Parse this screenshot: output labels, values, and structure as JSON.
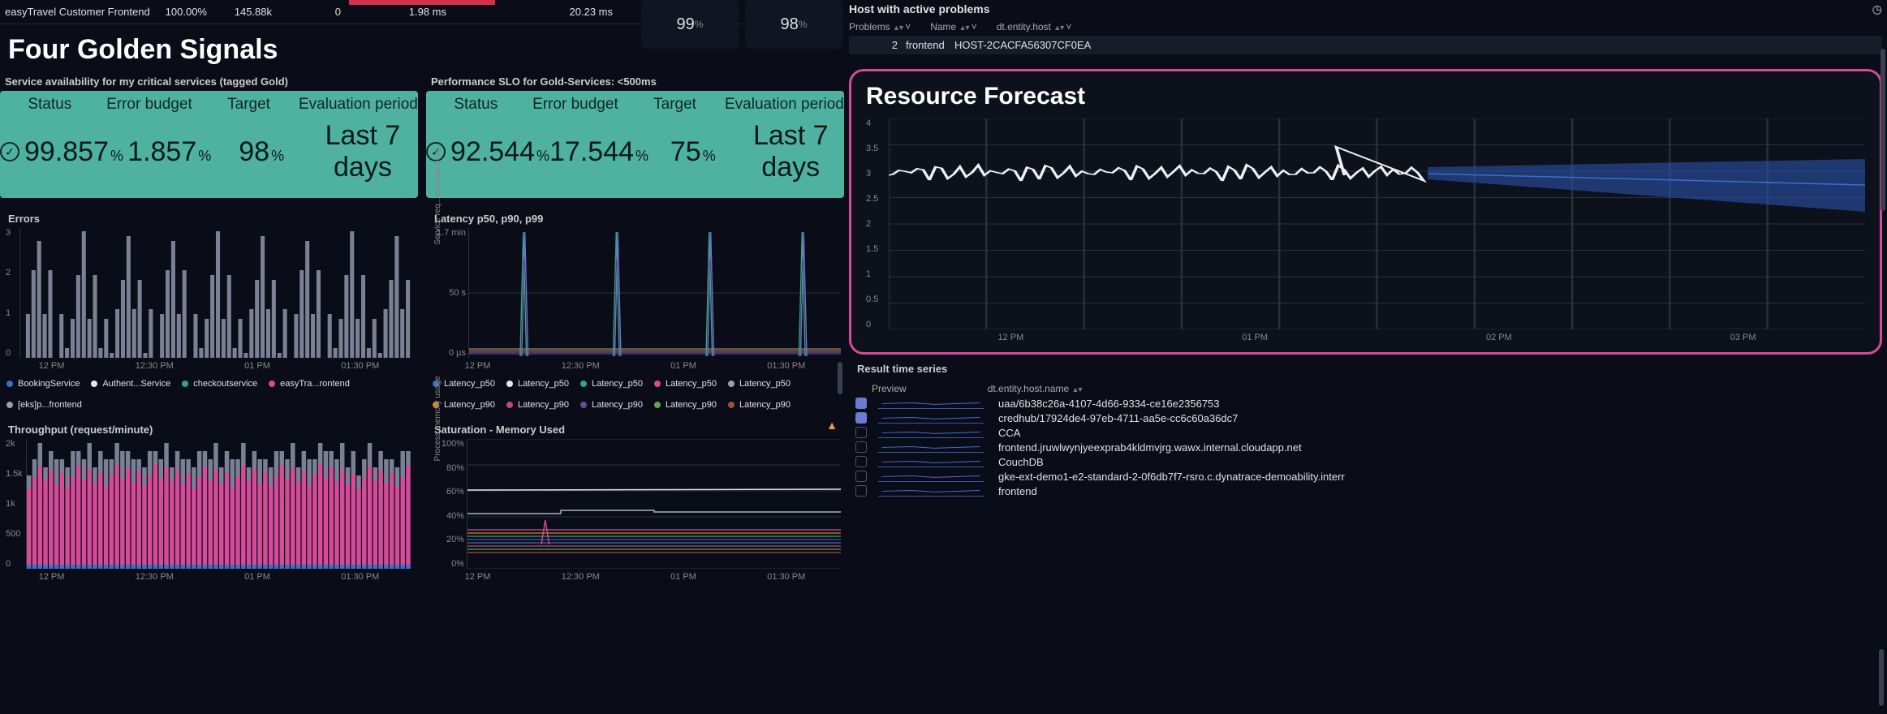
{
  "top_row": {
    "service": "easyTravel Customer Frontend",
    "pct": "100.00%",
    "val1": "145.88k",
    "val2": "0",
    "val3": "1.98 ms",
    "val4": "20.23 ms"
  },
  "gauges": {
    "g1": "99",
    "g1_unit": "%",
    "g2": "98",
    "g2_unit": "%"
  },
  "section_title": "Four Golden Signals",
  "slo1": {
    "title": "Service availability for my critical services (tagged Gold)",
    "headers": [
      "Status",
      "Error budget",
      "Target",
      "Evaluation period"
    ],
    "values": [
      "99.857",
      "1.857",
      "98",
      "Last 7 days"
    ]
  },
  "slo2": {
    "title": "Performance SLO for Gold-Services: <500ms",
    "headers": [
      "Status",
      "Error budget",
      "Target",
      "Evaluation period"
    ],
    "values": [
      "92.544",
      "17.544",
      "75",
      "Last 7 days"
    ]
  },
  "errors_chart": {
    "title": "Errors",
    "ylabels": [
      "3",
      "2",
      "1",
      "0"
    ],
    "xlabels": [
      "12 PM",
      "12:30 PM",
      "01 PM",
      "01:30 PM"
    ],
    "legend": [
      {
        "c": "#3b6fc9",
        "t": "BookingService"
      },
      {
        "c": "#e8e8e8",
        "t": "Authent...Service"
      },
      {
        "c": "#2fa87a",
        "t": "checkoutservice"
      },
      {
        "c": "#d64a9a",
        "t": "easyTra...rontend"
      },
      {
        "c": "#9aa0a6",
        "t": "[eks]p...frontend"
      }
    ]
  },
  "latency_chart": {
    "title": "Latency p50, p90, p99",
    "ylabels": [
      "1.7 min",
      "50 s",
      "0 µs"
    ],
    "ylabel_rot": "Service req...esponse time",
    "xlabels": [
      "12 PM",
      "12:30 PM",
      "01 PM",
      "01:30 PM"
    ],
    "legend": [
      {
        "c": "#3b6fc9",
        "t": "Latency_p50"
      },
      {
        "c": "#e8e8e8",
        "t": "Latency_p50"
      },
      {
        "c": "#2fa87a",
        "t": "Latency_p50"
      },
      {
        "c": "#d64a9a",
        "t": "Latency_p50"
      },
      {
        "c": "#9aa0a6",
        "t": "Latency_p50"
      },
      {
        "c": "#c98b2f",
        "t": "Latency_p90"
      },
      {
        "c": "#c14a6f",
        "t": "Latency_p90"
      },
      {
        "c": "#6a4aa0",
        "t": "Latency_p90"
      },
      {
        "c": "#6aa04a",
        "t": "Latency_p90"
      },
      {
        "c": "#a04a4a",
        "t": "Latency_p90"
      }
    ]
  },
  "throughput_chart": {
    "title": "Throughput (request/minute)",
    "ylabels": [
      "2k",
      "1.5k",
      "1k",
      "500",
      "0"
    ],
    "xlabels": [
      "12 PM",
      "12:30 PM",
      "01 PM",
      "01:30 PM"
    ]
  },
  "saturation_chart": {
    "title": "Saturation - Memory Used",
    "ylabels": [
      "100%",
      "80%",
      "60%",
      "40%",
      "20%",
      "0%"
    ],
    "ylabel_rot": "Process memory usage",
    "xlabels": [
      "12 PM",
      "12:30 PM",
      "01 PM",
      "01:30 PM"
    ]
  },
  "host_problems": {
    "title": "Host with active problems",
    "cols": [
      "Problems",
      "Name",
      "dt.entity.host"
    ],
    "row": {
      "problems": "2",
      "name": "frontend",
      "entity": "HOST-2CACFA56307CF0EA"
    }
  },
  "forecast": {
    "title": "Resource Forecast",
    "ylabels": [
      "4",
      "3.5",
      "3",
      "2.5",
      "2",
      "1.5",
      "1",
      "0.5",
      "0"
    ],
    "xlabels": [
      "12 PM",
      "01 PM",
      "02 PM",
      "03 PM"
    ]
  },
  "results": {
    "title": "Result time series",
    "cols": [
      "Preview",
      "dt.entity.host.name"
    ],
    "rows": [
      {
        "checked": true,
        "name": "uaa/6b38c26a-4107-4d66-9334-ce16e2356753"
      },
      {
        "checked": true,
        "name": "credhub/17924de4-97eb-4711-aa5e-cc6c60a36dc7"
      },
      {
        "checked": false,
        "name": "CCA"
      },
      {
        "checked": false,
        "name": "frontend.jruwlwynjyeexprab4kldmvjrg.wawx.internal.cloudapp.net"
      },
      {
        "checked": false,
        "name": "CouchDB"
      },
      {
        "checked": false,
        "name": "gke-ext-demo1-e2-standard-2-0f6db7f7-rsro.c.dynatrace-demoability.interr"
      },
      {
        "checked": false,
        "name": "frontend"
      }
    ]
  },
  "chart_data": [
    {
      "type": "bar",
      "title": "Errors",
      "xlabel": "",
      "ylabel": "",
      "ylim": [
        0,
        3
      ],
      "x_time_range": [
        "12:00 PM",
        "02:00 PM"
      ],
      "note": "roughly 60 1-min bars, values between 0 and 3, colored per legend"
    },
    {
      "type": "line",
      "title": "Latency p50, p90, p99",
      "ylabel": "Service request response time",
      "y_ticks": [
        "0 µs",
        "50 s",
        "1.7 min"
      ],
      "x_time_range": [
        "12:00 PM",
        "02:00 PM"
      ],
      "note": "p50 flat near 0; periodic spikes to ~1.7 min roughly every 30 min"
    },
    {
      "type": "bar",
      "title": "Throughput (request/minute)",
      "ylim": [
        0,
        2000
      ],
      "x_time_range": [
        "12:00 PM",
        "02:00 PM"
      ],
      "note": "stacked pink/grey bars ~1.4k-1.8k per minute"
    },
    {
      "type": "line",
      "title": "Saturation - Memory Used",
      "ylim": [
        0,
        100
      ],
      "y_unit": "%",
      "x_time_range": [
        "12:00 PM",
        "02:00 PM"
      ],
      "note": "cluster of flat lines 15%-35%, one ~62%, one stepping ~42-46%"
    },
    {
      "type": "line",
      "title": "Resource Forecast",
      "ylim": [
        0,
        4
      ],
      "x_time_range": [
        "12:00 PM",
        "03:30 PM"
      ],
      "note": "white observed noisy line ~3 until ~01:50 PM; then blue forecast band widening, median ~2.3-2.8"
    }
  ]
}
